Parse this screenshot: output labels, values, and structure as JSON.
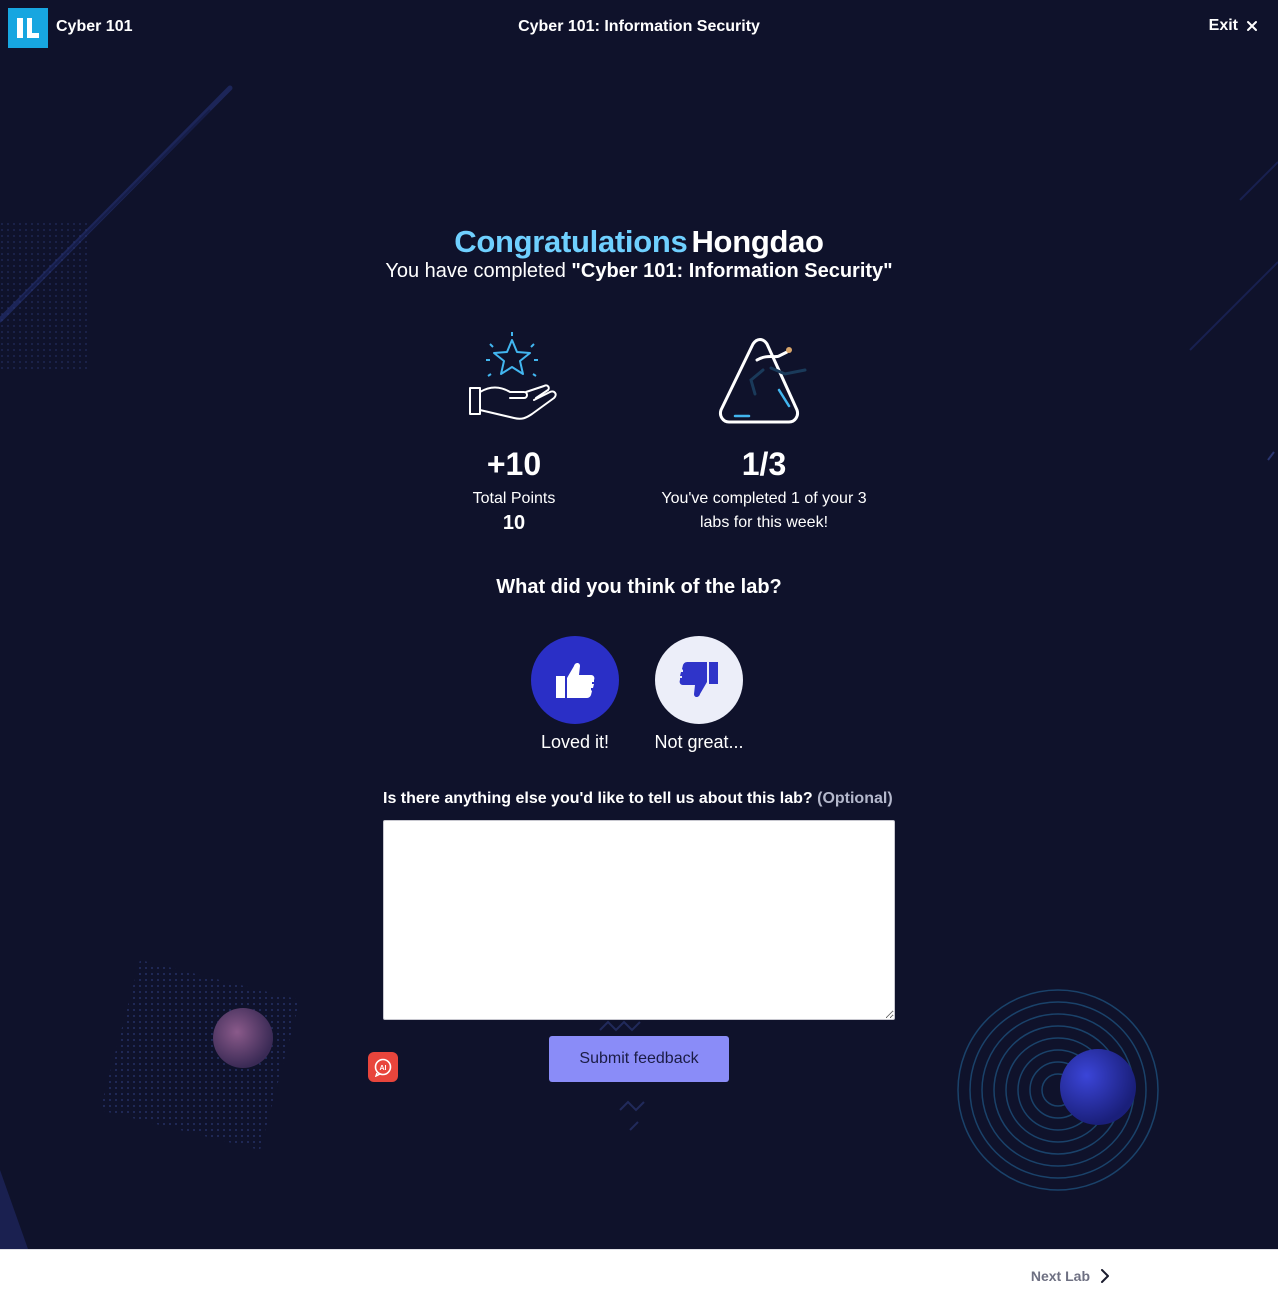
{
  "header": {
    "app_name": "Cyber 101",
    "title": "Cyber 101: Information Security",
    "exit_label": "Exit",
    "logo_text": "IL"
  },
  "completion": {
    "congrats_word": "Congratulations",
    "user_name": "Hongdao",
    "completed_prefix": "You have completed ",
    "completed_lab": "\"Cyber 101: Information Security\""
  },
  "stats": {
    "points_big": "+10",
    "points_label": "Total Points",
    "points_total": "10",
    "labs_big": "1/3",
    "labs_label_line1": "You've completed 1 of your 3",
    "labs_label_line2": "labs for this week!"
  },
  "feedback": {
    "question": "What did you think of the lab?",
    "loved_label": "Loved it!",
    "not_great_label": "Not great...",
    "comment_label": "Is there anything else you'd like to tell us about this lab?",
    "comment_optional": "(Optional)",
    "comment_value": "",
    "submit_label": "Submit feedback"
  },
  "footer": {
    "next_label": "Next Lab"
  },
  "icons": {
    "exit": "close-icon",
    "next": "chevron-right-icon",
    "loved": "thumbs-up-icon",
    "not_great": "thumbs-down-icon",
    "points": "star-hand-icon",
    "labs": "runner-triangle-icon",
    "ai": "ai-assistant-icon"
  },
  "colors": {
    "background": "#0f122b",
    "accent_cyan": "#6fd0ff",
    "logo_blue": "#17a6e0",
    "thumbs_up_bg": "#2a2fc6",
    "thumbs_down_bg": "#eceef9",
    "submit_bg": "#8a8cf8",
    "ai_badge": "#e8453c"
  }
}
